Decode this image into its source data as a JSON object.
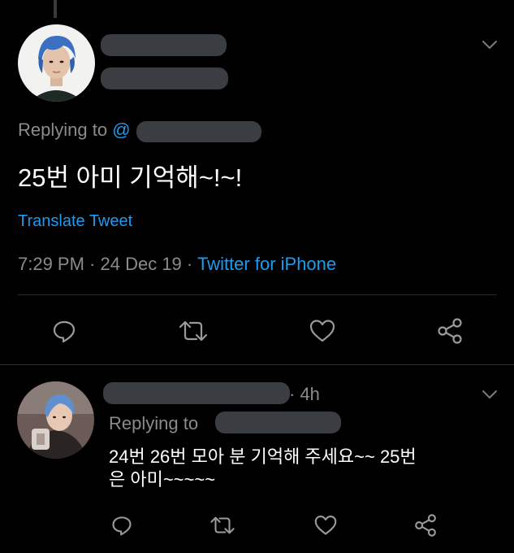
{
  "main_tweet": {
    "replying_to": "Replying to",
    "at_symbol": "@",
    "text": "25번 아미 기억해~!~!",
    "translate": "Translate Tweet",
    "time": "7:29 PM",
    "sep1": " · ",
    "date": "24 Dec 19",
    "sep2": " · ",
    "source": "Twitter for iPhone"
  },
  "reply_tweet": {
    "age": "· 4h",
    "replying_to": "Replying to",
    "text_line1": "24번 26번 모아 분 기억해 주세요~~ 25번",
    "text_line2": "은 아미~~~~~"
  },
  "icons": {
    "chevron": "chevron-down-icon",
    "reply": "reply-icon",
    "retweet": "retweet-icon",
    "like": "heart-icon",
    "share": "share-icon"
  },
  "colors": {
    "background": "#000000",
    "text": "#d9d9d9",
    "secondary": "#8b8b8b",
    "link": "#1d9bf0",
    "redaction": "#3a3d41"
  }
}
